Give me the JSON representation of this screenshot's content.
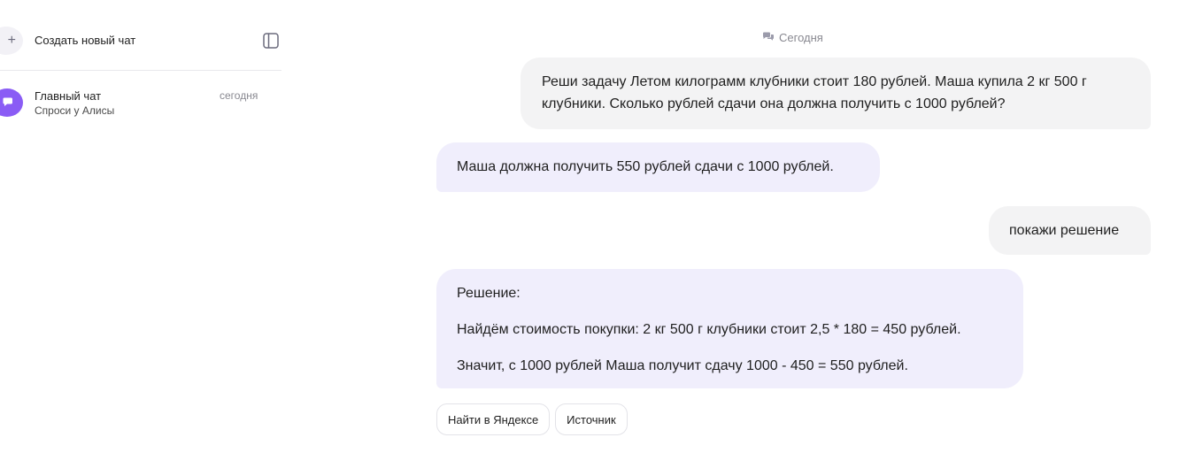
{
  "sidebar": {
    "new_chat_label": "Создать новый чат",
    "chats": [
      {
        "title": "Главный чат",
        "subtitle": "Спроси у Алисы",
        "date": "сегодня"
      }
    ]
  },
  "main": {
    "date_separator": "Сегодня",
    "messages": [
      {
        "role": "user",
        "text": "Реши задачу Летом килограмм клубники стоит 180 рублей. Маша купила 2 кг 500 г клубники. Сколько рублей сдачи она должна получить с 1000 рублей?"
      },
      {
        "role": "assistant",
        "text": "Маша должна получить 550 рублей сдачи с 1000 рублей."
      },
      {
        "role": "user",
        "text": "покажи решение"
      },
      {
        "role": "assistant",
        "paragraphs": [
          "Решение:",
          "Найдём стоимость покупки: 2 кг 500 г клубники стоит 2,5 * 180 = 450 рублей.",
          "Значит, с 1000 рублей Маша получит сдачу 1000 - 450 = 550 рублей."
        ]
      }
    ],
    "actions": [
      "Найти в Яндексе",
      "Источник"
    ]
  },
  "colors": {
    "accent": "#8a5cf5",
    "user_bubble": "#f3f3f4",
    "assistant_bubble": "#f0eefc",
    "muted_text": "#888890"
  },
  "icons": {
    "new_chat": "plus-icon",
    "sidebar_toggle": "sidebar-toggle-icon",
    "chat_avatar": "chat-bubble-icon",
    "date_separator": "chat-bubbles-icon"
  }
}
